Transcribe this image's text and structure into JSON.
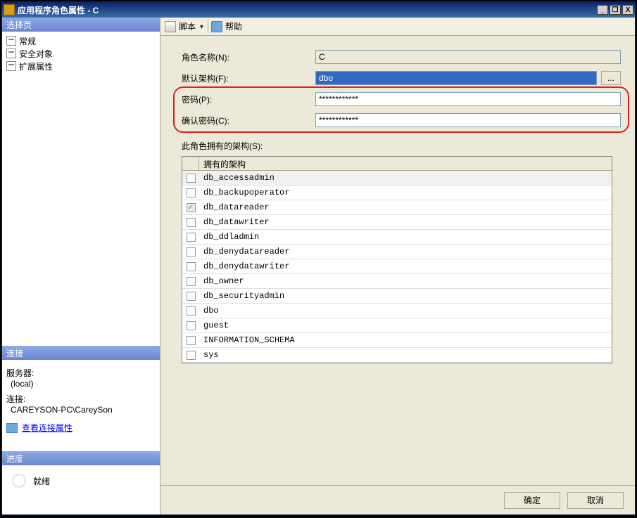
{
  "titlebar": {
    "title": "应用程序角色属性 - C"
  },
  "window_buttons": {
    "min": "_",
    "restore": "❐",
    "close": "X"
  },
  "sidebar": {
    "select_page_header": "选择页",
    "pages": [
      {
        "label": "常规"
      },
      {
        "label": "安全对象"
      },
      {
        "label": "扩展属性"
      }
    ],
    "connection_header": "连接",
    "server_label": "服务器:",
    "server_value": "(local)",
    "conn_label": "连接:",
    "conn_value": "CAREYSON-PC\\CareySon",
    "view_conn_link": "查看连接属性",
    "progress_header": "进度",
    "ready_label": "就绪"
  },
  "toolbar": {
    "script_label": "脚本",
    "help_label": "帮助"
  },
  "form": {
    "role_name_label": "角色名称(N):",
    "role_name_value": "C",
    "default_schema_label": "默认架构(F):",
    "default_schema_value": "dbo",
    "browse_label": "...",
    "password_label": "密码(P):",
    "password_value": "************",
    "confirm_password_label": "确认密码(C):",
    "confirm_password_value": "************",
    "schemas_owned_label": "此角色拥有的架构(S):",
    "schema_column_header": "拥有的架构"
  },
  "schemas": [
    {
      "name": "db_accessadmin",
      "checked": false,
      "selected": true
    },
    {
      "name": "db_backupoperator",
      "checked": false
    },
    {
      "name": "db_datareader",
      "checked": true,
      "disabled": true
    },
    {
      "name": "db_datawriter",
      "checked": false
    },
    {
      "name": "db_ddladmin",
      "checked": false
    },
    {
      "name": "db_denydatareader",
      "checked": false
    },
    {
      "name": "db_denydatawriter",
      "checked": false
    },
    {
      "name": "db_owner",
      "checked": false
    },
    {
      "name": "db_securityadmin",
      "checked": false
    },
    {
      "name": "dbo",
      "checked": false
    },
    {
      "name": "guest",
      "checked": false
    },
    {
      "name": "INFORMATION_SCHEMA",
      "checked": false
    },
    {
      "name": "sys",
      "checked": false
    }
  ],
  "footer": {
    "ok_label": "确定",
    "cancel_label": "取消"
  }
}
